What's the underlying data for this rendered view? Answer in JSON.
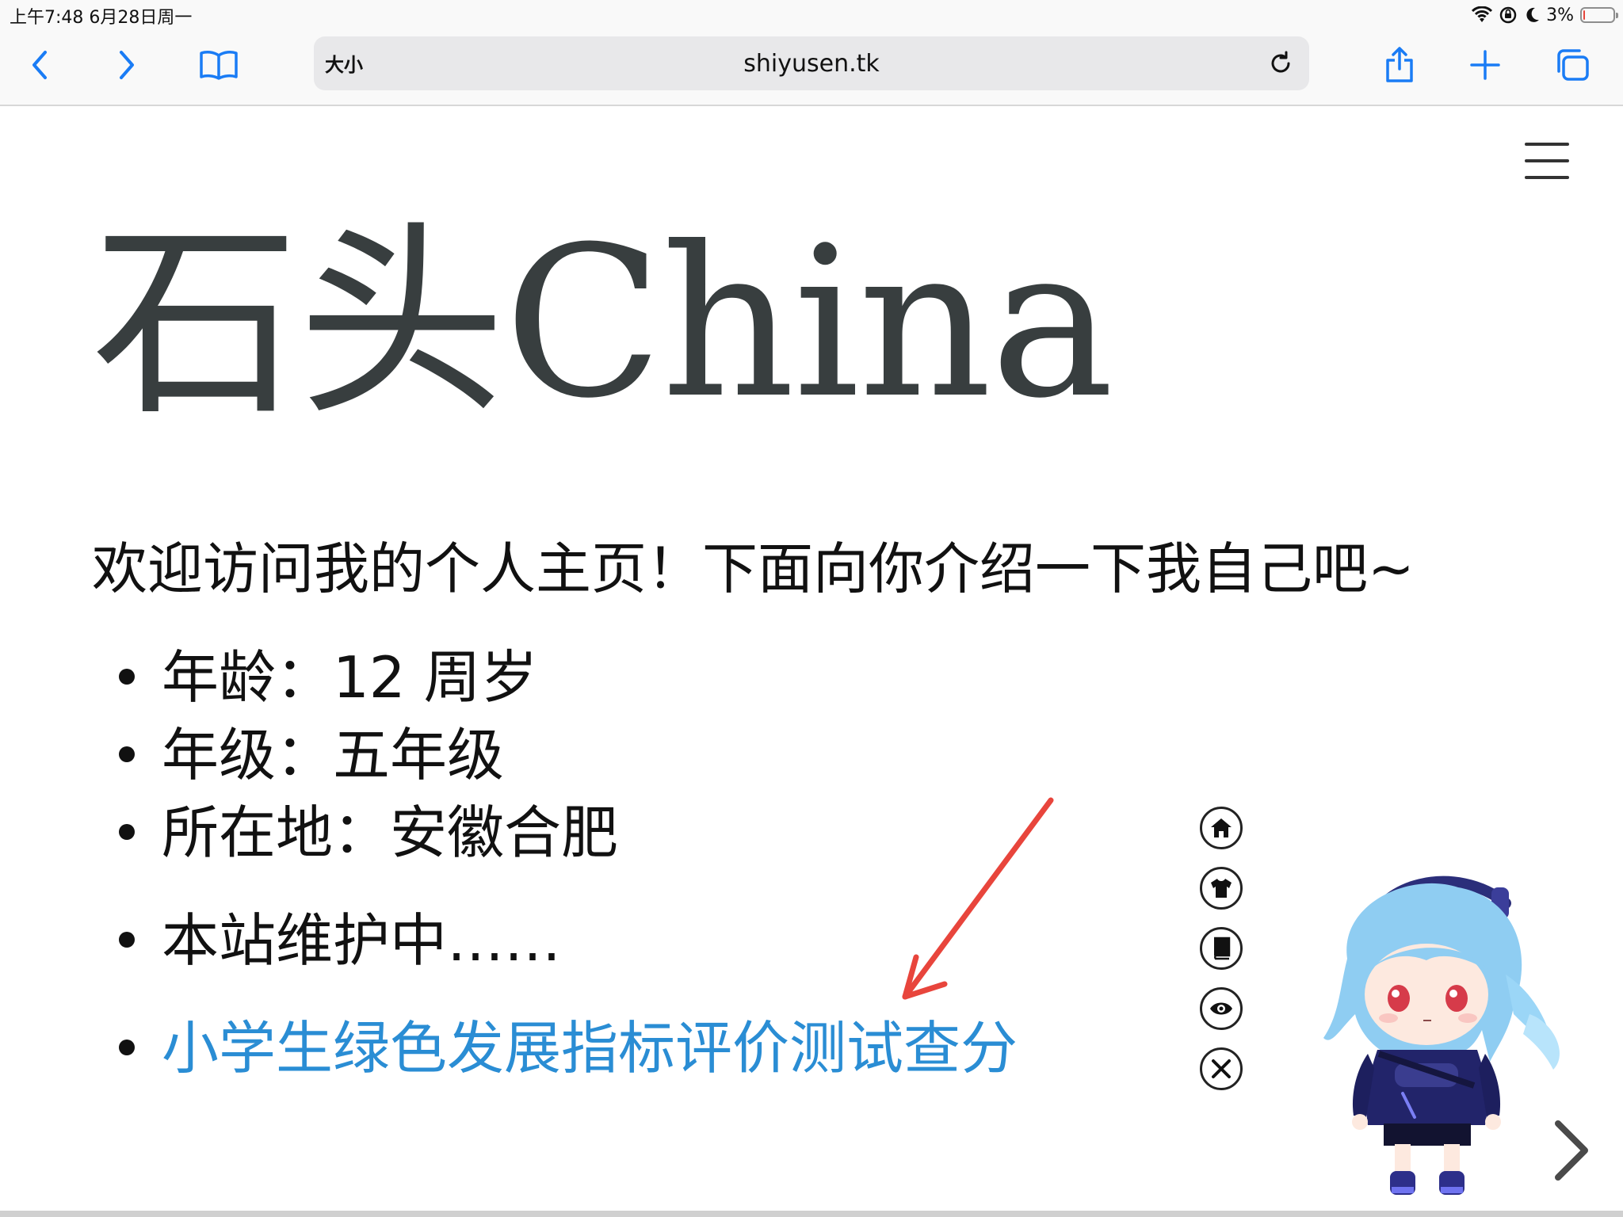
{
  "status_bar": {
    "time": "上午7:48   6月28日周一",
    "battery_pct": "3%",
    "battery_level": 0.03
  },
  "toolbar": {
    "text_size_label": "大小",
    "url": "shiyusen.tk"
  },
  "page": {
    "title": "石头China",
    "intro": "欢迎访问我的个人主页！下面向你介绍一下我自己吧~",
    "items": [
      "年龄：12 周岁",
      "年级：五年级",
      "所在地：安徽合肥",
      "本站维护中……"
    ],
    "link_text": "小学生绿色发展指标评价测试查分"
  },
  "widget": {
    "tools": [
      "home-icon",
      "shirt-icon",
      "book-icon",
      "eye-icon",
      "close-icon"
    ]
  },
  "colors": {
    "link": "#2a8dd4",
    "arrow": "#e8453c",
    "title": "#383e3f",
    "accent": "#1a7cf5"
  }
}
